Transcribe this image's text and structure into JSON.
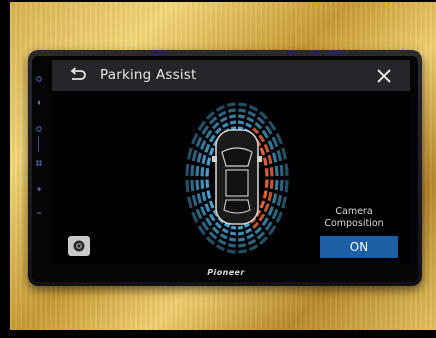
{
  "header": {
    "title": "Parking Assist"
  },
  "camera": {
    "label_line1": "Camera",
    "label_line2": "Composition",
    "toggle_state": "ON"
  },
  "device": {
    "brand": "Pioneer"
  },
  "colors": {
    "accent": "#1c5fa3",
    "sensor_near": "#e8663a",
    "sensor_far": "#4aa8d8"
  },
  "icons": [
    "back-arrow-icon",
    "close-icon",
    "camera-icon",
    "power-icon",
    "mic-icon",
    "nav-icon",
    "apps-icon",
    "volume-up-icon",
    "volume-down-icon"
  ]
}
